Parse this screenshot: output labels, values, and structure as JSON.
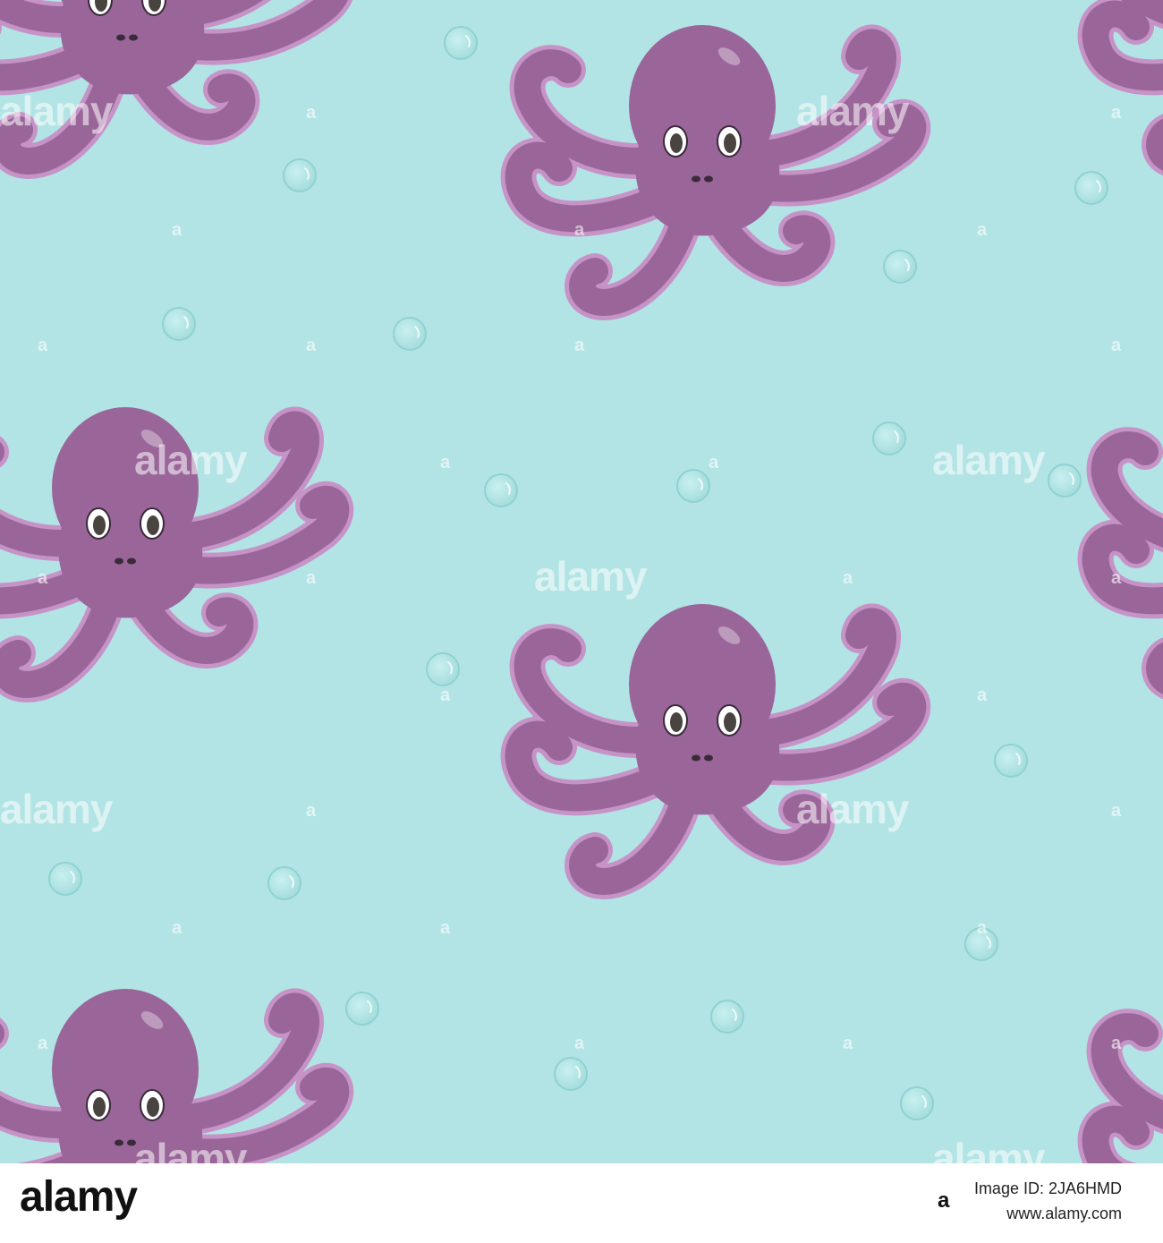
{
  "scene": {
    "background_color": "#b3e4e5",
    "octopus_body_color": "#9a6699",
    "octopus_suction_color": "#c693c6",
    "bubble_color": "#8fd2d2",
    "octopus_icon": "octopus-icon",
    "bubble_icon": "bubble-icon"
  },
  "watermark": {
    "text": "alamy",
    "letter": "a"
  },
  "footer": {
    "logo": "alamy",
    "letter": "a",
    "image_id_line": "Image ID: 2JA6HMD",
    "site_line": "www.alamy.com"
  }
}
